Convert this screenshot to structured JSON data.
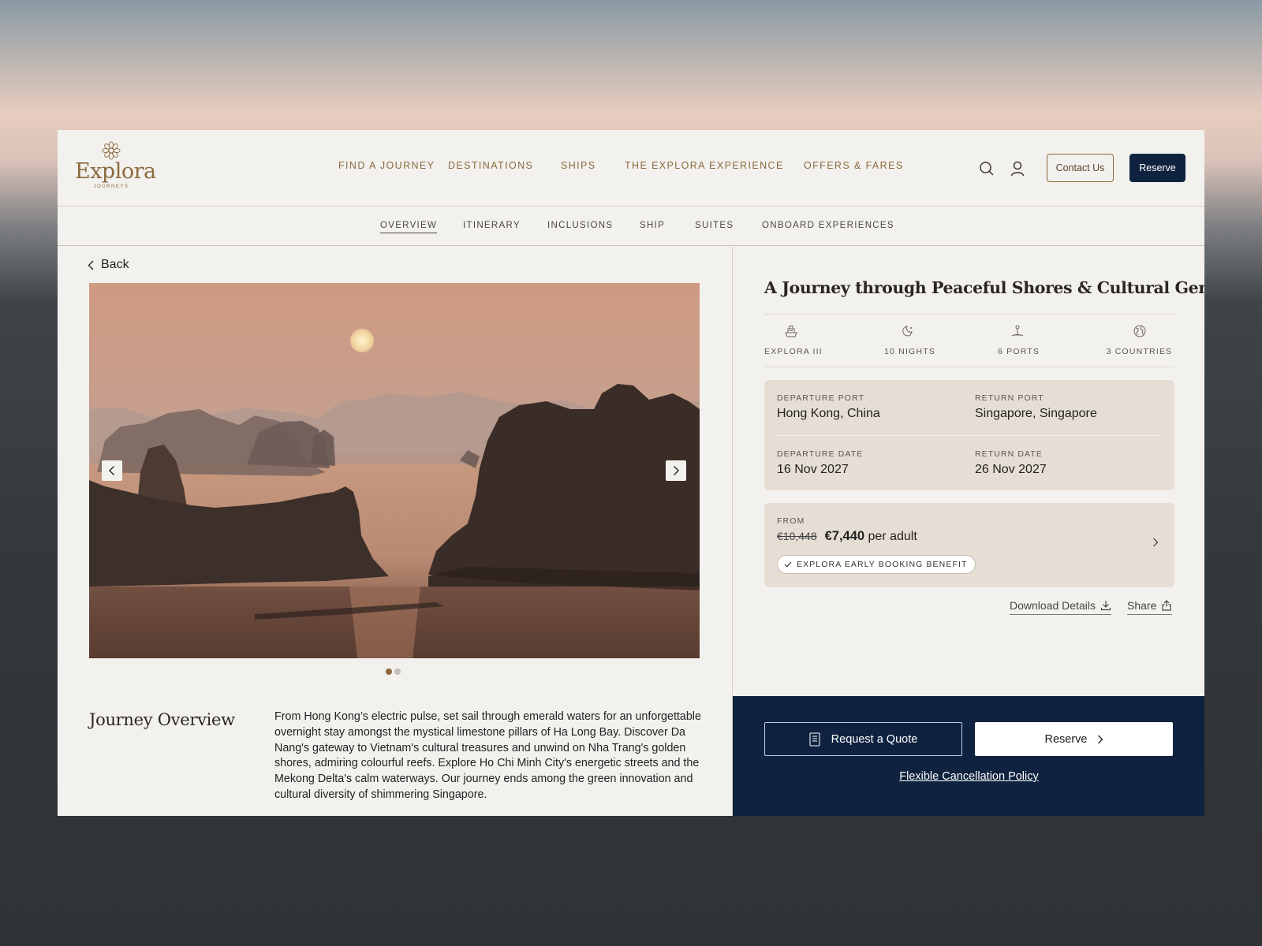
{
  "brand": {
    "name": "Explora",
    "sub": "JOURNEYS"
  },
  "nav": {
    "items": [
      "FIND A JOURNEY",
      "DESTINATIONS",
      "SHIPS",
      "THE EXPLORA EXPERIENCE",
      "OFFERS & FARES"
    ],
    "contact_label": "Contact Us",
    "reserve_label": "Reserve"
  },
  "subnav": {
    "items": [
      "OVERVIEW",
      "ITINERARY",
      "INCLUSIONS",
      "SHIP",
      "SUITES",
      "ONBOARD EXPERIENCES"
    ],
    "active": "OVERVIEW"
  },
  "back_label": "Back",
  "gallery": {
    "slides": 2,
    "current": 1
  },
  "overview": {
    "title": "Journey Overview",
    "text": "From Hong Kong’s electric pulse, set sail through emerald waters for an unforgettable overnight stay amongst the mystical limestone pillars of Ha Long Bay. Discover Da Nang's gateway to Vietnam's cultural treasures and unwind on Nha Trang's golden shores, admiring colourful reefs. Explore Ho Chi Minh City's energetic streets and the Mekong Delta's calm waterways. Our journey ends among the green innovation and cultural diversity of shimmering Singapore."
  },
  "journey": {
    "title": "A Journey through Peaceful Shores & Cultural Gems",
    "stats": [
      {
        "icon": "ship-icon",
        "label": "EXPLORA III"
      },
      {
        "icon": "moon-icon",
        "label": "10 NIGHTS"
      },
      {
        "icon": "port-pin-icon",
        "label": "6 PORTS"
      },
      {
        "icon": "globe-icon",
        "label": "3 COUNTRIES"
      }
    ],
    "ports": {
      "departure_port_label": "DEPARTURE PORT",
      "departure_port": "Hong Kong, China",
      "return_port_label": "RETURN PORT",
      "return_port": "Singapore, Singapore",
      "departure_date_label": "DEPARTURE DATE",
      "departure_date": "16 Nov 2027",
      "return_date_label": "RETURN DATE",
      "return_date": "26 Nov 2027"
    },
    "price": {
      "from_label": "FROM",
      "old": "€10,448",
      "new": "€7,440",
      "per": "per adult",
      "benefit": "EXPLORA EARLY BOOKING BENEFIT"
    },
    "download_label": "Download Details",
    "share_label": "Share"
  },
  "cta": {
    "quote_label": "Request a Quote",
    "reserve_label": "Reserve",
    "policy_label": "Flexible Cancellation Policy"
  },
  "colors": {
    "accent_gold": "#8b6a3e",
    "navy": "#0f2340",
    "panel_beige": "#e6ded5",
    "page_bg": "#f3f1ee"
  }
}
